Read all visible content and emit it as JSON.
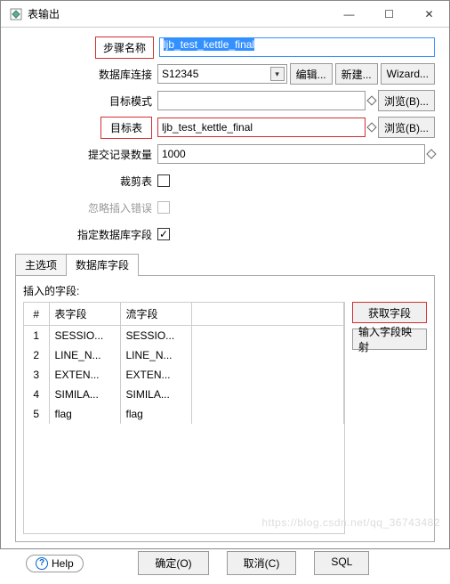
{
  "window": {
    "title": "表输出",
    "minimize": "—",
    "maximize": "☐",
    "close": "✕"
  },
  "form": {
    "step_name_label": "步骤名称",
    "step_name_value": "ljb_test_kettle_final",
    "db_conn_label": "数据库连接",
    "db_conn_value": "S12345",
    "edit_btn": "编辑...",
    "new_btn": "新建...",
    "wizard_btn": "Wizard...",
    "target_schema_label": "目标模式",
    "target_schema_value": "",
    "browse_b_btn": "浏览(B)...",
    "target_table_label": "目标表",
    "target_table_value": "ljb_test_kettle_final",
    "commit_size_label": "提交记录数量",
    "commit_size_value": "1000",
    "truncate_label": "裁剪表",
    "ignore_insert_err_label": "忽略插入错误",
    "specify_db_fields_label": "指定数据库字段",
    "checkmark": "✓"
  },
  "tabs": {
    "main": "主选项",
    "db_fields": "数据库字段"
  },
  "table": {
    "section_label": "插入的字段:",
    "header_num": "#",
    "header_table_field": "表字段",
    "header_stream_field": "流字段",
    "rows": [
      {
        "n": "1",
        "t": "SESSIO...",
        "s": "SESSIO..."
      },
      {
        "n": "2",
        "t": "LINE_N...",
        "s": "LINE_N..."
      },
      {
        "n": "3",
        "t": "EXTEN...",
        "s": "EXTEN..."
      },
      {
        "n": "4",
        "t": "SIMILA...",
        "s": "SIMILA..."
      },
      {
        "n": "5",
        "t": "flag",
        "s": "flag"
      }
    ],
    "get_fields_btn": "获取字段",
    "input_field_map_btn": "输入字段映射"
  },
  "footer": {
    "help": "Help",
    "ok": "确定(O)",
    "cancel": "取消(C)",
    "sql": "SQL"
  },
  "watermark": "https://blog.csdn.net/qq_36743482"
}
